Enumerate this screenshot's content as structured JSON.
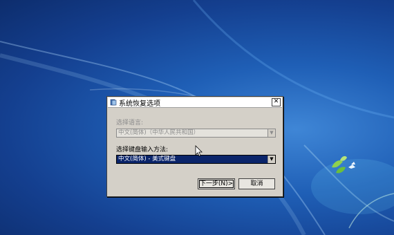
{
  "dialog": {
    "title": "系统恢复选项",
    "close_label": "✕",
    "language_label": "选择语言:",
    "language_value": "中文(简体)（中华人民共和国）",
    "keyboard_label": "选择键盘输入方法:",
    "keyboard_value": "中文(简体) - 美式键盘",
    "next_button": "下一步(N)>",
    "cancel_button": "取消"
  },
  "icons": {
    "title": "recovery-icon",
    "dropdown": "chevron-down-icon",
    "cursor": "mouse-cursor-icon"
  },
  "colors": {
    "desktop": "#1f5fb6",
    "dialog": "#d4d0c8",
    "selection": "#0a246a"
  }
}
